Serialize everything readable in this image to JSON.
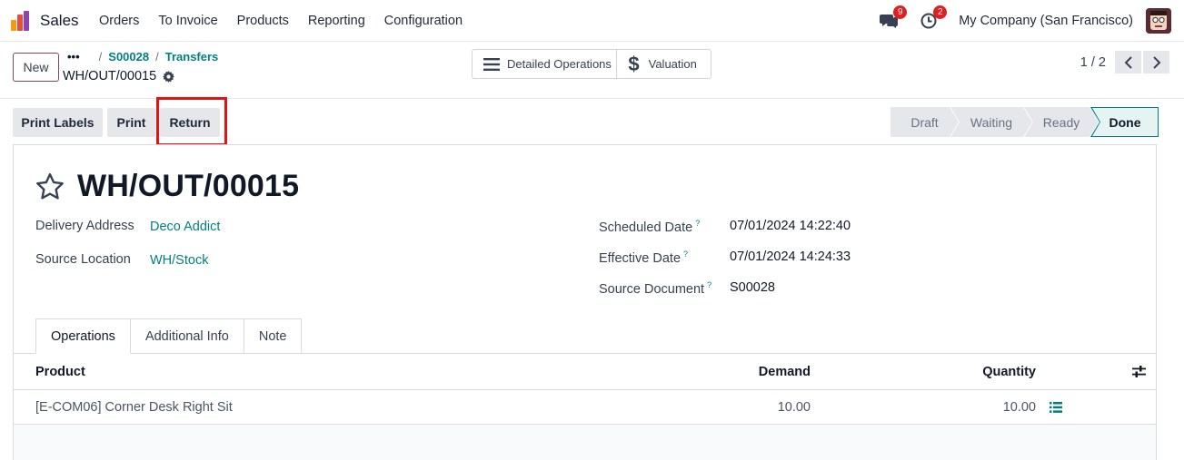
{
  "navbar": {
    "app_name": "Sales",
    "menu": [
      "Orders",
      "To Invoice",
      "Products",
      "Reporting",
      "Configuration"
    ],
    "messages_badge": "9",
    "activities_badge": "2",
    "company": "My Company (San Francisco)",
    "icons": {
      "logo": "odoo-sales-logo",
      "messages": "chat-icon",
      "activities": "clock-icon",
      "avatar": "user-avatar"
    }
  },
  "control": {
    "new_label": "New",
    "breadcrumb_dots": "•••",
    "breadcrumb_sep": "/",
    "breadcrumbs": [
      "S00028",
      "Transfers"
    ],
    "record": "WH/OUT/00015",
    "smart_buttons": [
      {
        "label": "Detailed Operations",
        "icon": "list-icon"
      },
      {
        "label": "Valuation",
        "icon": "dollar-icon"
      }
    ],
    "pager": "1 / 2"
  },
  "statusbar": {
    "actions": [
      "Print Labels",
      "Print",
      "Return"
    ],
    "highlighted_action": "Return",
    "highlight_color": "#e81010",
    "stages": [
      "Draft",
      "Waiting",
      "Ready",
      "Done"
    ],
    "current_stage": "Done"
  },
  "form": {
    "title": "WH/OUT/00015",
    "left_fields": [
      {
        "label": "Delivery Address",
        "value": "Deco Addict"
      },
      {
        "label": "Source Location",
        "value": "WH/Stock"
      }
    ],
    "right_fields": [
      {
        "label": "Scheduled Date",
        "help": "?",
        "value": "07/01/2024 14:22:40"
      },
      {
        "label": "Effective Date",
        "help": "?",
        "value": "07/01/2024 14:24:33"
      },
      {
        "label": "Source Document",
        "help": "?",
        "value": "S00028"
      }
    ],
    "tabs": [
      "Operations",
      "Additional Info",
      "Note"
    ],
    "active_tab": "Operations"
  },
  "table": {
    "headers": {
      "product": "Product",
      "demand": "Demand",
      "quantity": "Quantity"
    },
    "rows": [
      {
        "product": "[E-COM06] Corner Desk Right Sit",
        "demand": "10.00",
        "quantity": "10.00"
      }
    ]
  },
  "colors": {
    "accent": "#017e84",
    "brand": "#7c4a5f"
  }
}
